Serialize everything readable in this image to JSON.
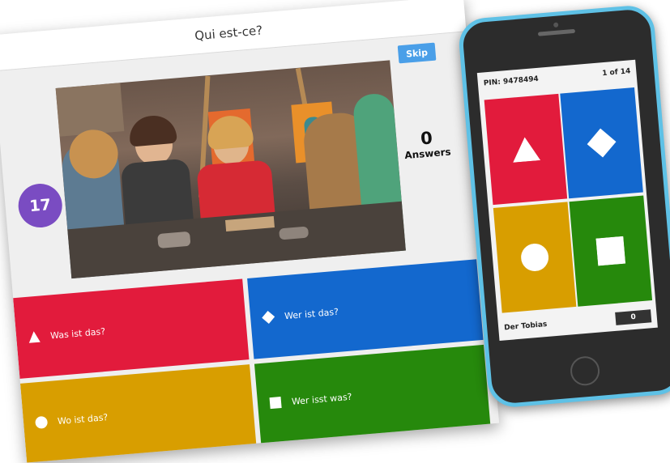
{
  "desktop": {
    "question": "Qui est-ce?",
    "skip_label": "Skip",
    "timer": "17",
    "answers_count": "0",
    "answers_label": "Answers",
    "answers": [
      {
        "label": "Was ist das?",
        "shape": "triangle-icon",
        "color": "#e21b3c"
      },
      {
        "label": "Wer ist das?",
        "shape": "diamond-icon",
        "color": "#1368ce"
      },
      {
        "label": "Wo ist das?",
        "shape": "circle-icon",
        "color": "#d89e00"
      },
      {
        "label": "Wer isst was?",
        "shape": "square-icon",
        "color": "#26890c"
      }
    ],
    "timer_color": "#7a4cc2",
    "skip_color": "#4a9fe8"
  },
  "phone": {
    "pin": "PIN: 9478494",
    "progress": "1 of 14",
    "player_name": "Der Tobias",
    "score": "0",
    "frame_color": "#5ec1e6"
  }
}
